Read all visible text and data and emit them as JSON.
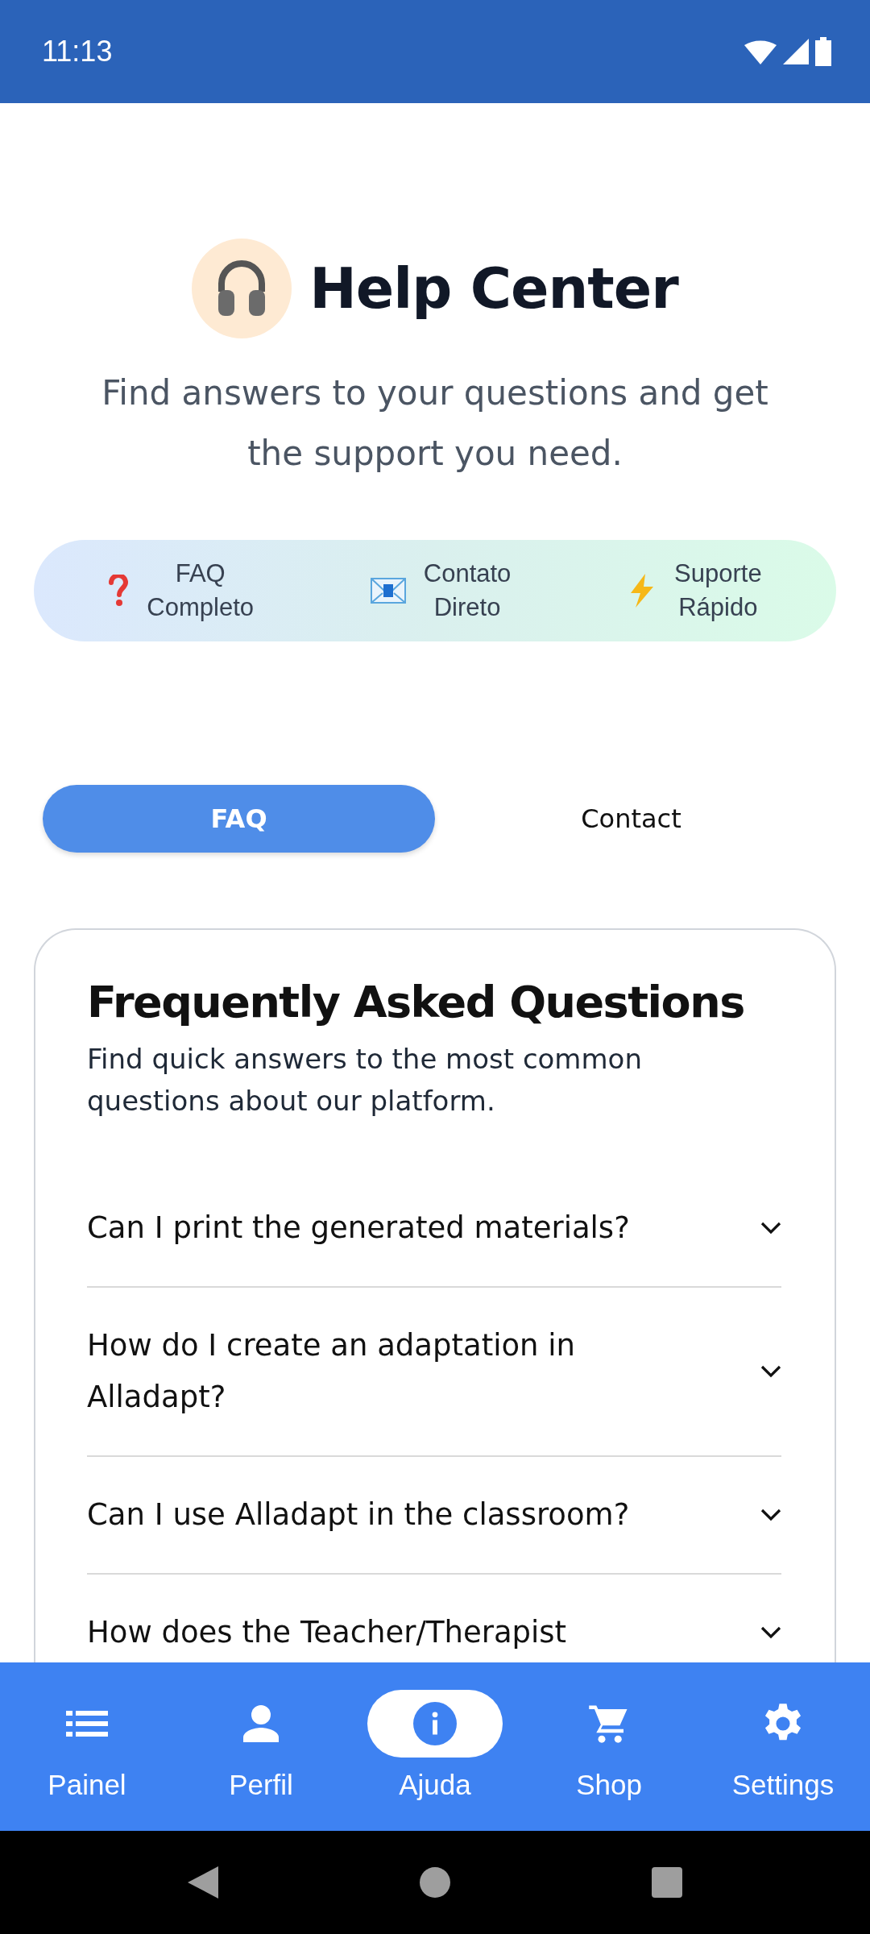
{
  "status_bar": {
    "time": "11:13"
  },
  "header": {
    "title": "Help Center",
    "subtitle": "Find answers to your questions and get the support you need."
  },
  "features": [
    {
      "line1": "FAQ",
      "line2": "Completo"
    },
    {
      "line1": "Contato",
      "line2": "Direto"
    },
    {
      "line1": "Suporte",
      "line2": "Rápido"
    }
  ],
  "tabs": [
    {
      "label": "FAQ",
      "selected": true
    },
    {
      "label": "Contact",
      "selected": false
    }
  ],
  "faq": {
    "title": "Frequently Asked Questions",
    "description": "Find quick answers to the most common questions about our platform.",
    "questions": [
      {
        "text": "Can I print the generated materials?",
        "expanded": false
      },
      {
        "text": "How do I create an adaptation in Alladapt?",
        "expanded": false
      },
      {
        "text": "Can I use Alladapt in the classroom?",
        "expanded": false
      },
      {
        "text": "How does the Teacher/Therapist",
        "expanded": false
      }
    ]
  },
  "bottom_nav": [
    {
      "label": "Painel",
      "selected": false
    },
    {
      "label": "Perfil",
      "selected": false
    },
    {
      "label": "Ajuda",
      "selected": true
    },
    {
      "label": "Shop",
      "selected": false
    },
    {
      "label": "Settings",
      "selected": false
    }
  ]
}
